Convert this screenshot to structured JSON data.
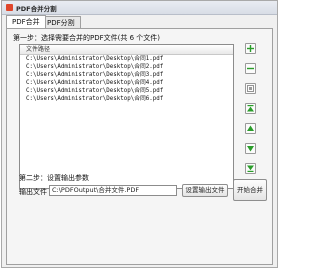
{
  "window": {
    "title": "PDF合并分割"
  },
  "tabs": [
    {
      "label": "PDF合并"
    },
    {
      "label": "PDF分割"
    }
  ],
  "step1": {
    "label": "第一步：选择需要合并的PDF文件(共 6 个文件)",
    "list_header": "文件路径",
    "files": [
      "C:\\Users\\Administrator\\Desktop\\合同1.pdf",
      "C:\\Users\\Administrator\\Desktop\\合同2.pdf",
      "C:\\Users\\Administrator\\Desktop\\合同3.pdf",
      "C:\\Users\\Administrator\\Desktop\\合同4.pdf",
      "C:\\Users\\Administrator\\Desktop\\合同5.pdf",
      "C:\\Users\\Administrator\\Desktop\\合同6.pdf"
    ]
  },
  "side_buttons": [
    {
      "icon": "add-icon",
      "color": "#2a9d2a"
    },
    {
      "icon": "remove-icon",
      "color": "#2a9d2a"
    },
    {
      "icon": "clear-icon",
      "color": "#7a7a7a"
    },
    {
      "icon": "move-top-icon",
      "color": "#2a9d2a"
    },
    {
      "icon": "move-up-icon",
      "color": "#2a9d2a"
    },
    {
      "icon": "move-down-icon",
      "color": "#2a9d2a"
    },
    {
      "icon": "move-bottom-icon",
      "color": "#2a9d2a"
    }
  ],
  "step2": {
    "label": "第二步：设置输出参数",
    "output_label": "输出文件",
    "output_value": "C:\\PDFOutput\\合并文件.PDF",
    "set_output_button": "设置输出文件",
    "start_button": "开始合并"
  }
}
